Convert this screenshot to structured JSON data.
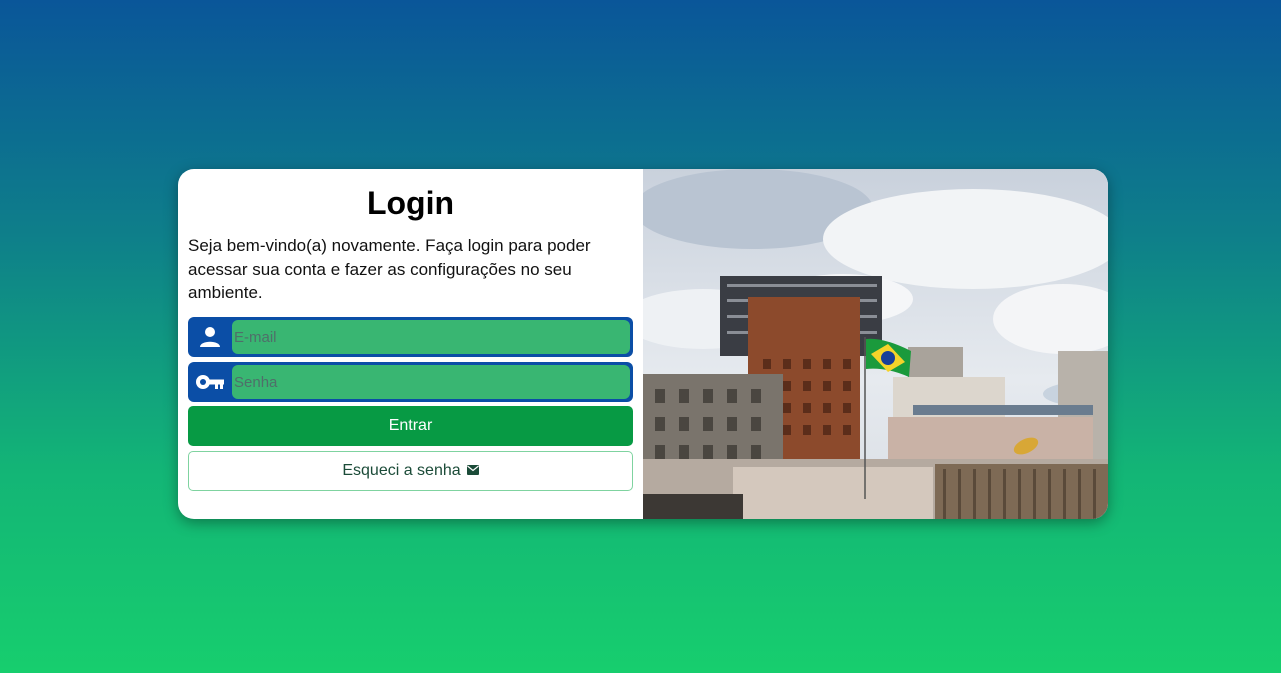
{
  "login": {
    "title": "Login",
    "description": "Seja bem-vindo(a) novamente. Faça login para poder acessar sua conta e fazer as configurações no seu ambiente.",
    "email_placeholder": "E-mail",
    "password_placeholder": "Senha",
    "submit_label": "Entrar",
    "forgot_label": "Esqueci a senha"
  },
  "icons": {
    "email_field": "user-icon",
    "password_field": "key-icon",
    "forgot": "envelope-icon"
  },
  "colors": {
    "field_border": "#0b4ea6",
    "field_fill": "#39b672",
    "primary_button": "#079a44"
  }
}
